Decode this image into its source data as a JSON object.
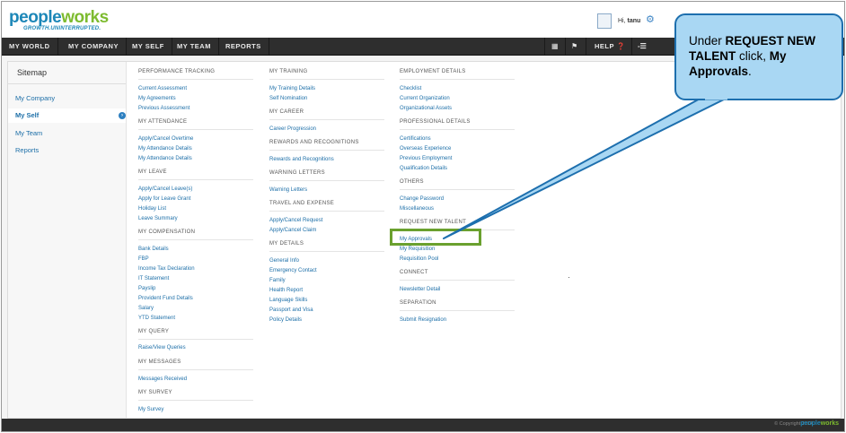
{
  "header": {
    "logo_prefix": "pe",
    "logo_mid": "ople",
    "logo_work": "works",
    "logo_tagline": "GROWTH.UNINTERRUPTED.",
    "greeting": "Hi,",
    "username": "tanu"
  },
  "nav": {
    "items": [
      "MY WORLD",
      "MY COMPANY",
      "MY SELF",
      "MY TEAM",
      "REPORTS"
    ],
    "help": "HELP"
  },
  "sidebar": {
    "title": "Sitemap",
    "items": [
      "My Company",
      "My Self",
      "My Team",
      "Reports"
    ]
  },
  "columns": [
    {
      "sections": [
        {
          "title": "PERFORMANCE TRACKING",
          "links": [
            "Current Assessment",
            "My Agreements",
            "Previous Assessment"
          ]
        },
        {
          "title": "MY ATTENDANCE",
          "links": [
            "Apply/Cancel Overtime",
            "My Attendance Details",
            "My Attendance Details"
          ]
        },
        {
          "title": "MY LEAVE",
          "links": [
            "Apply/Cancel Leave(s)",
            "Apply for Leave Grant",
            "Holiday List",
            "Leave Summary"
          ]
        },
        {
          "title": "MY COMPENSATION",
          "links": [
            "Bank Details",
            "FBP",
            "Income Tax Declaration",
            "IT Statement",
            "Payslip",
            "Provident Fund Details",
            "Salary",
            "YTD Statement"
          ]
        },
        {
          "title": "MY QUERY",
          "links": [
            "Raise/View Queries"
          ]
        },
        {
          "title": "MY MESSAGES",
          "links": [
            "Messages Received"
          ]
        },
        {
          "title": "MY SURVEY",
          "links": [
            "My Survey"
          ]
        }
      ]
    },
    {
      "sections": [
        {
          "title": "MY TRAINING",
          "links": [
            "My Training Details",
            "Self Nomination"
          ]
        },
        {
          "title": "MY CAREER",
          "links": [
            "Career Progression"
          ]
        },
        {
          "title": "REWARDS AND RECOGNITIONS",
          "links": [
            "Rewards and Recognitions"
          ]
        },
        {
          "title": "WARNING LETTERS",
          "links": [
            "Warning Letters"
          ]
        },
        {
          "title": "TRAVEL AND EXPENSE",
          "links": [
            "Apply/Cancel Request",
            "Apply/Cancel Claim"
          ]
        },
        {
          "title": "MY DETAILS",
          "links": [
            "General Info",
            "Emergency Contact",
            "Family",
            "Health Report",
            "Language Skills",
            "Passport and Visa",
            "Policy Details"
          ]
        }
      ]
    },
    {
      "sections": [
        {
          "title": "EMPLOYMENT DETAILS",
          "links": [
            "Checklist",
            "Current Organization",
            "Organizational Assets"
          ]
        },
        {
          "title": "PROFESSIONAL DETAILS",
          "links": [
            "Certifications",
            "Overseas Experience",
            "Previous Employment",
            "Qualification Details"
          ]
        },
        {
          "title": "OTHERS",
          "links": [
            "Change Password",
            "Miscellaneous"
          ]
        },
        {
          "title": "REQUEST NEW TALENT",
          "links": [
            "My Approvals",
            "My Requisition",
            "Requisition Pool"
          ]
        },
        {
          "title": "CONNECT",
          "links": [
            "Newsletter Detail"
          ]
        },
        {
          "title": "SEPARATION",
          "links": [
            "Submit Resignation"
          ]
        }
      ]
    }
  ],
  "footer": {
    "copyright": "© Copyright 2014",
    "logo_prefix": "people",
    "logo_work": "works"
  },
  "callout": {
    "text_1": "Under ",
    "bold_1": "REQUEST NEW TALENT",
    "text_2": " click, ",
    "bold_2": "My Approvals",
    "text_3": "."
  },
  "colors": {
    "brand_blue": "#1d87b8",
    "brand_green": "#7dbb2f",
    "nav_bg": "#2e2e2e",
    "link": "#1d6fa8",
    "callout_bg": "#a9d7f3",
    "highlight": "#6aa02e"
  }
}
